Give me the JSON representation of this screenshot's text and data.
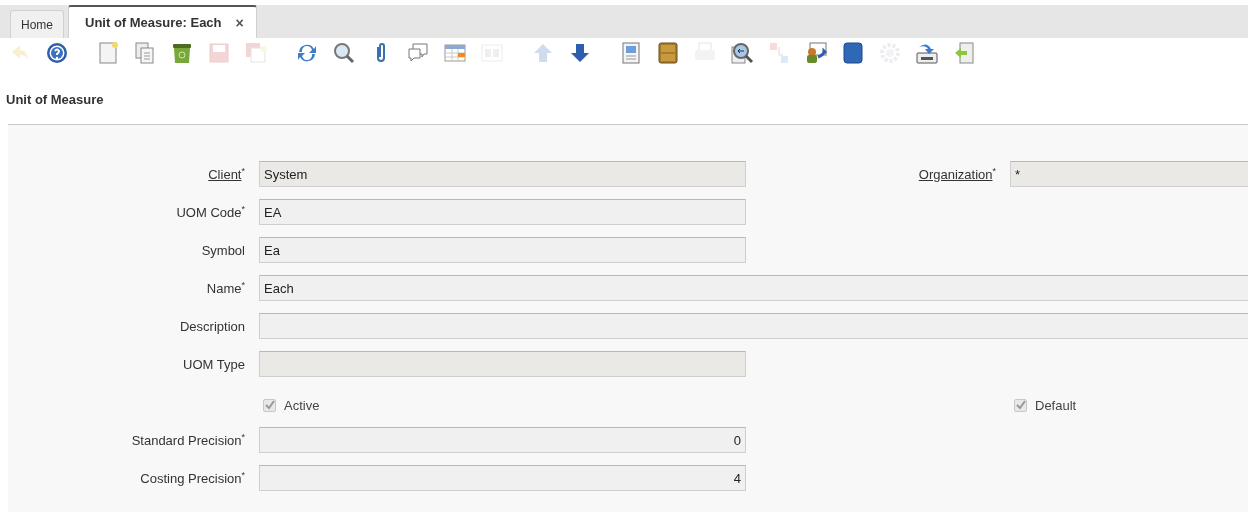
{
  "tabs": [
    {
      "label": "Home",
      "selected": false
    },
    {
      "label": "Unit of Measure: Each",
      "selected": true,
      "close": "×"
    }
  ],
  "toolbar": [
    [
      {
        "kind": "undo",
        "disabled": true
      },
      {
        "kind": "help",
        "disabled": false
      }
    ],
    [
      {
        "kind": "new",
        "disabled": false
      },
      {
        "kind": "copy",
        "disabled": false
      },
      {
        "kind": "delete",
        "disabled": false
      },
      {
        "kind": "save",
        "disabled": true
      },
      {
        "kind": "savenew",
        "disabled": true
      }
    ],
    [
      {
        "kind": "refresh",
        "disabled": false
      },
      {
        "kind": "find",
        "disabled": false
      },
      {
        "kind": "attach",
        "disabled": false
      },
      {
        "kind": "chat",
        "disabled": false
      },
      {
        "kind": "grid",
        "disabled": false
      },
      {
        "kind": "multi",
        "disabled": true
      }
    ],
    [
      {
        "kind": "up",
        "disabled": true
      },
      {
        "kind": "down",
        "disabled": false
      }
    ],
    [
      {
        "kind": "report",
        "disabled": false
      },
      {
        "kind": "archive",
        "disabled": false
      },
      {
        "kind": "print",
        "disabled": true
      },
      {
        "kind": "zoom",
        "disabled": false
      },
      {
        "kind": "requests",
        "disabled": true
      },
      {
        "kind": "workflow",
        "disabled": false
      },
      {
        "kind": "product",
        "disabled": false
      },
      {
        "kind": "process",
        "disabled": true
      },
      {
        "kind": "export",
        "disabled": false
      },
      {
        "kind": "import",
        "disabled": false
      }
    ]
  ],
  "section_title": "Unit of Measure",
  "rows": [
    [
      {
        "kind": "lookup",
        "label": "Client",
        "mark": "*",
        "link": true,
        "value": "System"
      },
      {
        "kind": "lookup",
        "label": "Organization",
        "mark": "*",
        "link": true,
        "value": "*"
      }
    ],
    [
      {
        "kind": "text",
        "label": "UOM Code",
        "mark": "*",
        "link": false,
        "value": "EA"
      }
    ],
    [
      {
        "kind": "text",
        "label": "Symbol",
        "link": false,
        "value": "Ea"
      }
    ],
    [
      {
        "kind": "wide",
        "label": "Name",
        "mark": "*",
        "link": false,
        "value": "Each"
      }
    ],
    [
      {
        "kind": "wide",
        "label": "Description",
        "link": false
      }
    ],
    [
      {
        "kind": "lookup",
        "label": "UOM Type",
        "link": false
      }
    ],
    [
      {
        "kind": "checkbox",
        "label": "Active",
        "checked": true
      },
      {
        "kind": "checkbox",
        "label": "Default",
        "checked": true
      }
    ],
    [
      {
        "kind": "number",
        "label": "Standard Precision",
        "mark": "*",
        "link": false,
        "value": "0"
      }
    ],
    [
      {
        "kind": "number",
        "label": "Costing Precision",
        "mark": "*",
        "link": false,
        "value": "4"
      }
    ]
  ]
}
